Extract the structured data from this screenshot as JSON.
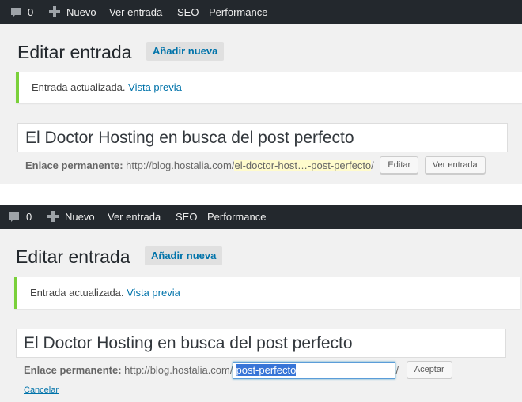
{
  "screens": [
    {
      "admin_bar": {
        "comment_count": "0",
        "new_label": "Nuevo",
        "view_post_label": "Ver entrada",
        "seo_label": "SEO",
        "performance_label": "Performance"
      },
      "page_title": "Editar entrada",
      "add_new_label": "Añadir nueva",
      "notice": {
        "text": "Entrada actualizada.",
        "link": "Vista previa"
      },
      "post_title": "El Doctor Hosting en busca del post perfecto",
      "permalink": {
        "label": "Enlace permanente:",
        "base": "http://blog.hostalia.com/",
        "slug": "el-doctor-host…-post-perfecto",
        "suffix": "/"
      },
      "buttons": {
        "edit": "Editar",
        "view": "Ver entrada"
      }
    },
    {
      "admin_bar": {
        "comment_count": "0",
        "new_label": "Nuevo",
        "view_post_label": "Ver entrada",
        "seo_label": "SEO",
        "performance_label": "Performance"
      },
      "page_title": "Editar entrada",
      "add_new_label": "Añadir nueva",
      "notice": {
        "text": "Entrada actualizada.",
        "link": "Vista previa"
      },
      "post_title": "El Doctor Hosting en busca del post perfecto",
      "permalink": {
        "label": "Enlace permanente:",
        "base": "http://blog.hostalia.com/",
        "slug_value": "post-perfecto",
        "suffix": "/"
      },
      "buttons": {
        "accept": "Aceptar",
        "cancel": "Cancelar"
      }
    }
  ],
  "colors": {
    "admin_bar": "#23282d",
    "link": "#0073aa",
    "notice_border": "#7ad03a",
    "slug_highlight": "#fffbcc",
    "selection": "#3875d7"
  },
  "icons": [
    "comment-icon",
    "plus-icon"
  ]
}
